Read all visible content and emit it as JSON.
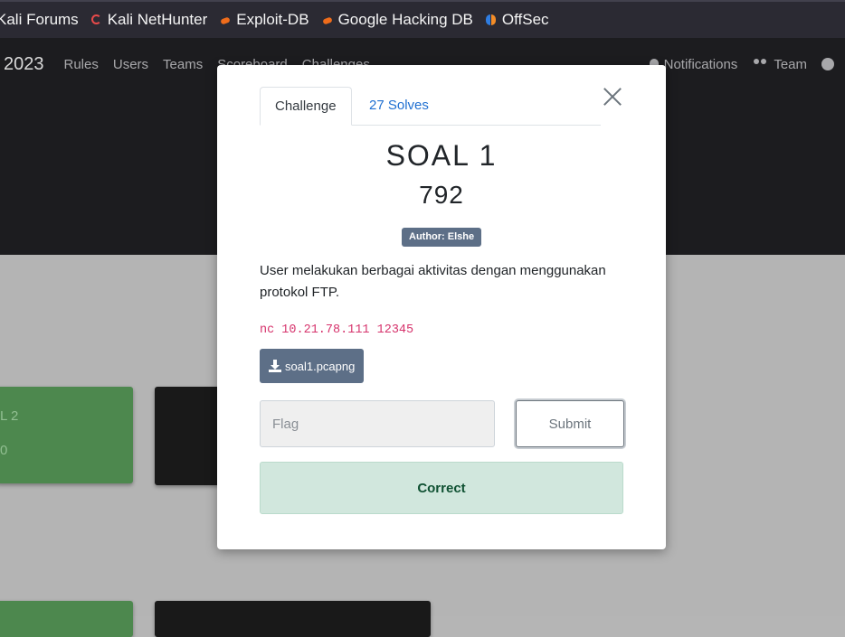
{
  "bookmarks": [
    {
      "label": "Kali Forums",
      "icon": "none"
    },
    {
      "label": "Kali NetHunter",
      "icon": "nethunter-icon"
    },
    {
      "label": "Exploit-DB",
      "icon": "exploit-db-icon"
    },
    {
      "label": "Google Hacking DB",
      "icon": "ghdb-icon"
    },
    {
      "label": "OffSec",
      "icon": "offsec-icon"
    }
  ],
  "navbar": {
    "brand": "2023",
    "links": [
      "Rules",
      "Users",
      "Teams",
      "Scoreboard",
      "Challenges"
    ],
    "notifications": "Notifications",
    "team": "Team"
  },
  "cards": {
    "green1_title": "L 2",
    "green1_points": "0"
  },
  "modal": {
    "tab_challenge": "Challenge",
    "tab_solves": "27 Solves",
    "title": "SOAL 1",
    "value": "792",
    "author_badge": "Author: Elshe",
    "description": "User melakukan berbagai aktivitas dengan menggunakan protokol FTP.",
    "code": "nc 10.21.78.111 12345",
    "file_label": "soal1.pcapng",
    "flag_placeholder": "Flag",
    "submit_label": "Submit",
    "result": "Correct"
  },
  "colors": {
    "badge": "#5d6f87",
    "success_bg": "#d1e7dd",
    "success_text": "#0f5132",
    "code": "#d6336c"
  }
}
